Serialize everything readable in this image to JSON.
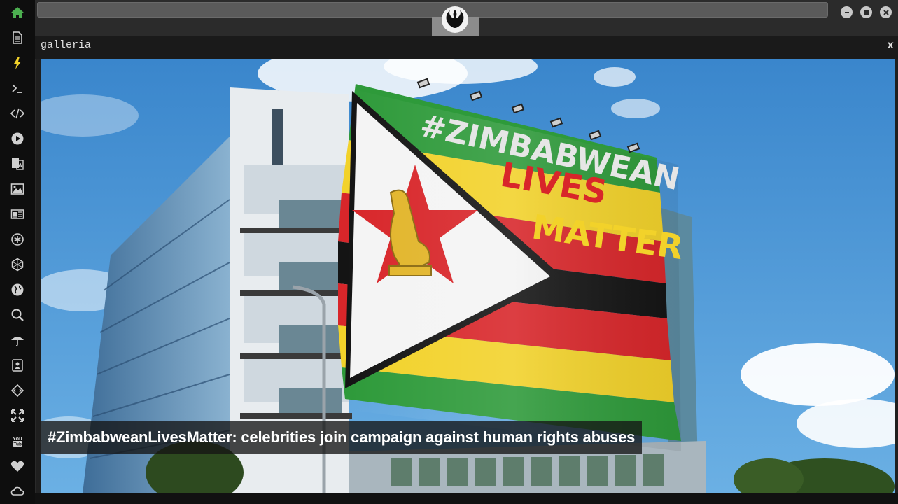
{
  "window": {
    "title": "galleria",
    "close_label": "x"
  },
  "sidebar": {
    "items": [
      {
        "name": "home-icon",
        "active": true
      },
      {
        "name": "document-icon"
      },
      {
        "name": "lightning-icon"
      },
      {
        "name": "terminal-icon"
      },
      {
        "name": "code-icon"
      },
      {
        "name": "play-icon"
      },
      {
        "name": "translate-icon"
      },
      {
        "name": "image-icon"
      },
      {
        "name": "newspaper-icon"
      },
      {
        "name": "asterisk-icon"
      },
      {
        "name": "hexagon-icon"
      },
      {
        "name": "globe-icon"
      },
      {
        "name": "search-icon"
      },
      {
        "name": "umbrella-icon"
      },
      {
        "name": "contacts-icon"
      },
      {
        "name": "diamond-code-icon"
      },
      {
        "name": "expand-icon"
      },
      {
        "name": "youtube-icon"
      },
      {
        "name": "heart-icon"
      },
      {
        "name": "cloud-icon"
      }
    ],
    "accent": "#4caf50"
  },
  "caption": "#ZimbabweanLivesMatter: celebrities join campaign against human rights abuses",
  "flag": {
    "line1": "#ZIMBABWEAN",
    "line2": "LIVES",
    "line3": "MATTER",
    "colors": {
      "green": "#2e9a3a",
      "yellow": "#f2d22a",
      "red": "#d8262a",
      "black": "#141414",
      "white": "#f4f4f4"
    }
  },
  "sky_color": "#3f8fd0"
}
